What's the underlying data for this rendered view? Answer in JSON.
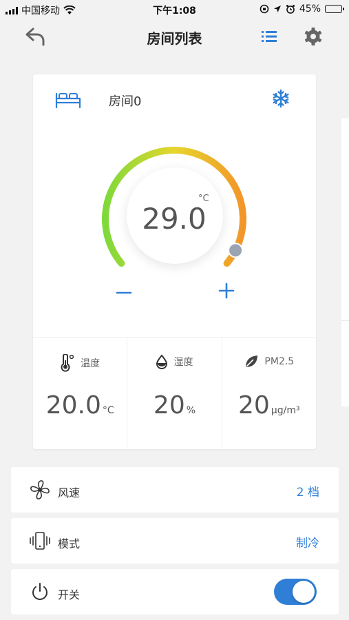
{
  "status_bar": {
    "carrier": "中国移动",
    "time": "下午1:08",
    "battery": "45%",
    "battery_level": 0.45
  },
  "navbar": {
    "title": "房间列表",
    "back_icon": "back-arrow-icon",
    "list_icon": "list-icon",
    "settings_icon": "gear-icon"
  },
  "colors": {
    "accent": "#2f7fd6",
    "dial_gradient": [
      "#7fd93a",
      "#e6d62e",
      "#f2962a"
    ],
    "knob": "#9aa4b3"
  },
  "room": {
    "name": "房间0",
    "mode_icon": "snowflake-icon",
    "temperature": "29.0",
    "temperature_unit": "°C",
    "dial_fraction": 0.95,
    "minus_label": "−",
    "plus_label": "+"
  },
  "stats": [
    {
      "icon": "thermometer-icon",
      "label": "温度",
      "value": "20.0",
      "unit": "°C"
    },
    {
      "icon": "water-drop-icon",
      "label": "湿度",
      "value": "20",
      "unit": "%"
    },
    {
      "icon": "leaf-icon",
      "label": "PM2.5",
      "value": "20",
      "unit": "μg/m³"
    }
  ],
  "controls": {
    "fan": {
      "icon": "fan-icon",
      "label": "风速",
      "value": "2 档"
    },
    "mode": {
      "icon": "vibrate-phone-icon",
      "label": "模式",
      "value": "制冷"
    },
    "power": {
      "icon": "power-icon",
      "label": "开关",
      "on": true
    }
  }
}
